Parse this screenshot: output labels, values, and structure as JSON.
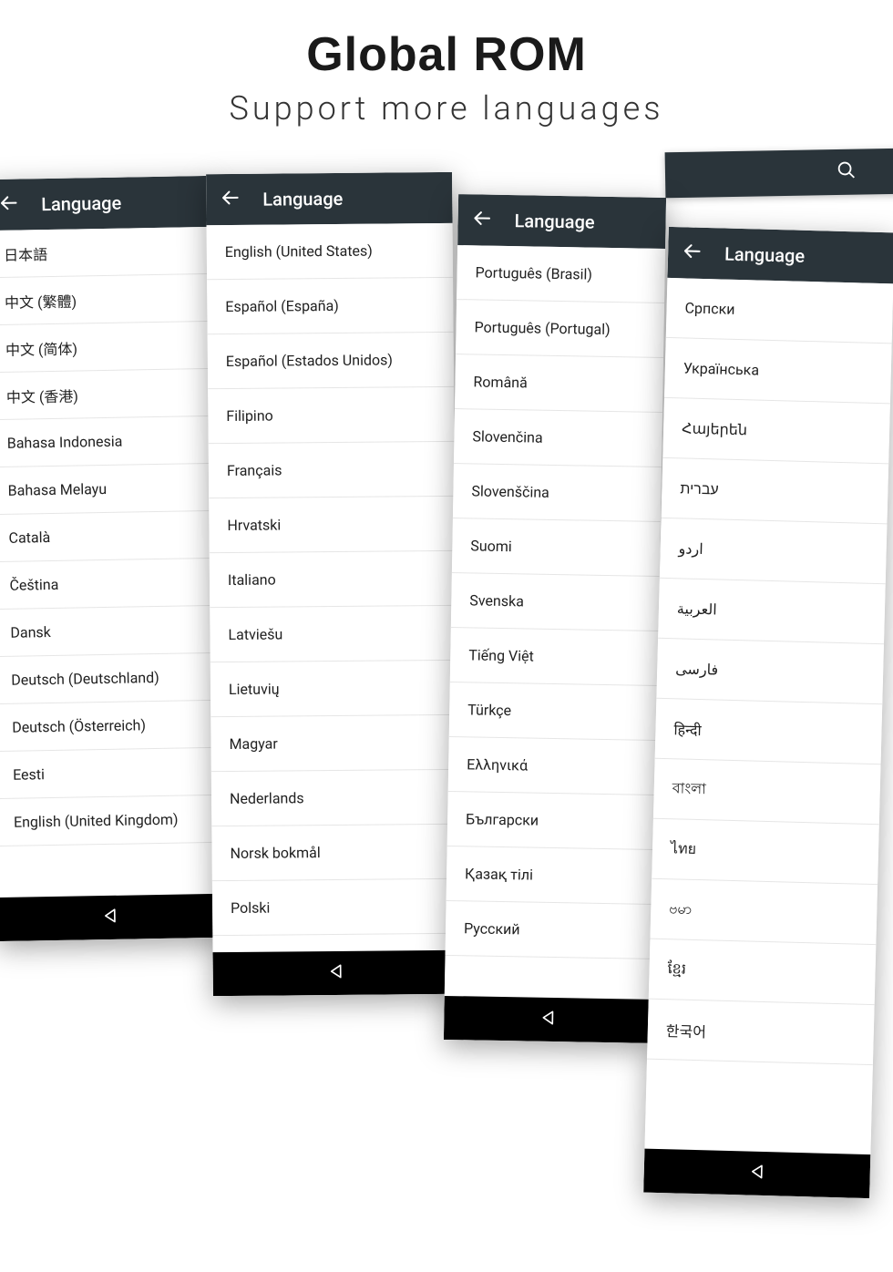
{
  "title": "Global ROM",
  "subtitle": "Support more languages",
  "header_label": "Language",
  "panels": [
    {
      "id": "p1",
      "row_h": "h52",
      "items": [
        "日本語",
        "中文 (繁體)",
        "中文 (简体)",
        "中文 (香港)",
        "Bahasa Indonesia",
        "Bahasa Melayu",
        "Català",
        "Čeština",
        "Dansk",
        "Deutsch (Deutschland)",
        "Deutsch (Österreich)",
        "Eesti",
        "English (United Kingdom)"
      ]
    },
    {
      "id": "p2",
      "row_h": "h60",
      "items": [
        "English (United States)",
        "Español (España)",
        "Español (Estados Unidos)",
        "Filipino",
        "Français",
        "Hrvatski",
        "Italiano",
        "Latviešu",
        "Lietuvių",
        "Magyar",
        "Nederlands",
        "Norsk bokmål",
        "Polski"
      ]
    },
    {
      "id": "p3",
      "row_h": "h60",
      "items": [
        "Português (Brasil)",
        "Português (Portugal)",
        "Română",
        "Slovenčina",
        "Slovenščina",
        "Suomi",
        "Svenska",
        "Tiếng Việt",
        "Türkçe",
        "Ελληνικά",
        "Български",
        "Қазақ тілі",
        "Русский"
      ]
    },
    {
      "id": "p4",
      "row_h": "h66",
      "items": [
        "Српски",
        "Українська",
        "Հայերեն",
        "עברית",
        "اردو",
        "العربية",
        "فارسی",
        "हिन्दी",
        "বাংলা",
        "ไทย",
        "ဗမာ",
        "ខ្មែរ",
        "한국어"
      ]
    }
  ]
}
